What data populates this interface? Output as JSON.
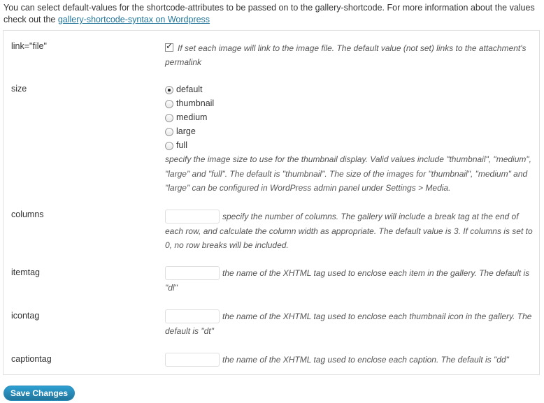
{
  "intro": {
    "text": "You can select default-values for the shortcode-attributes to be passed on to the gallery-shortcode. For more information about the values check out the ",
    "link_text": "gallery-shortcode-syntax on Wordpress"
  },
  "settings": {
    "link": {
      "label": "link=\"file\"",
      "checked": true,
      "description": "If set each image will link to the image file. The default value (not set) links to the attachment's permalink"
    },
    "size": {
      "label": "size",
      "options": [
        "default",
        "thumbnail",
        "medium",
        "large",
        "full"
      ],
      "selected": "default",
      "description": "specify the image size to use for the thumbnail display. Valid values include \"thumbnail\", \"medium\", \"large\" and \"full\". The default is \"thumbnail\". The size of the images for \"thumbnail\", \"medium\" and \"large\" can be configured in WordPress admin panel under Settings > Media."
    },
    "columns": {
      "label": "columns",
      "value": "",
      "description": "specify the number of columns. The gallery will include a break tag at the end of each row, and calculate the column width as appropriate. The default value is 3. If columns is set to 0, no row breaks will be included."
    },
    "itemtag": {
      "label": "itemtag",
      "value": "",
      "description": "the name of the XHTML tag used to enclose each item in the gallery. The default is \"dl\""
    },
    "icontag": {
      "label": "icontag",
      "value": "",
      "description": "the name of the XHTML tag used to enclose each thumbnail icon in the gallery. The default is \"dt\""
    },
    "captiontag": {
      "label": "captiontag",
      "value": "",
      "description": "the name of the XHTML tag used to enclose each caption. The default is \"dd\""
    }
  },
  "save_button": {
    "label": "Save Changes"
  }
}
